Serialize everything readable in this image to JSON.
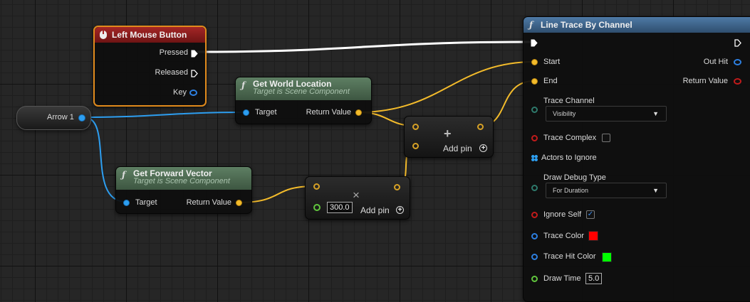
{
  "colors": {
    "exec_wire": "#ffffff",
    "vector_wire": "#f3bb2b",
    "object_wire": "#2d9ef0",
    "event_header": "#8c1c1c",
    "pure_header": "#4c6a52",
    "callable_header": "#3c5f88"
  },
  "event_node": {
    "title": "Left Mouse Button",
    "icon": "mouse-icon",
    "pins": {
      "pressed": "Pressed",
      "released": "Released",
      "key": "Key"
    }
  },
  "arrow_var": {
    "label": "Arrow 1"
  },
  "world_location": {
    "title": "Get World Location",
    "subtitle": "Target is Scene Component",
    "target": "Target",
    "return_value": "Return Value"
  },
  "forward_vector": {
    "title": "Get Forward Vector",
    "subtitle": "Target is Scene Component",
    "target": "Target",
    "return_value": "Return Value"
  },
  "add_node": {
    "op": "+",
    "add_pin": "Add pin",
    "add_icon": "plus-circle-icon"
  },
  "multiply_node": {
    "op": "×",
    "value": "300.0",
    "add_pin": "Add pin",
    "add_icon": "plus-circle-icon"
  },
  "line_trace": {
    "title": "Line Trace By Channel",
    "start": "Start",
    "end": "End",
    "out_hit": "Out Hit",
    "return_value": "Return Value",
    "trace_channel": "Trace Channel",
    "trace_channel_value": "Visibility",
    "trace_complex": "Trace Complex",
    "actors_to_ignore": "Actors to Ignore",
    "draw_debug_type": "Draw Debug Type",
    "draw_debug_value": "For Duration",
    "ignore_self": "Ignore Self",
    "trace_color": "Trace Color",
    "trace_color_value": "#ff0000",
    "trace_hit_color": "Trace Hit Color",
    "trace_hit_color_value": "#00ff00",
    "draw_time": "Draw Time",
    "draw_time_value": "5.0"
  }
}
